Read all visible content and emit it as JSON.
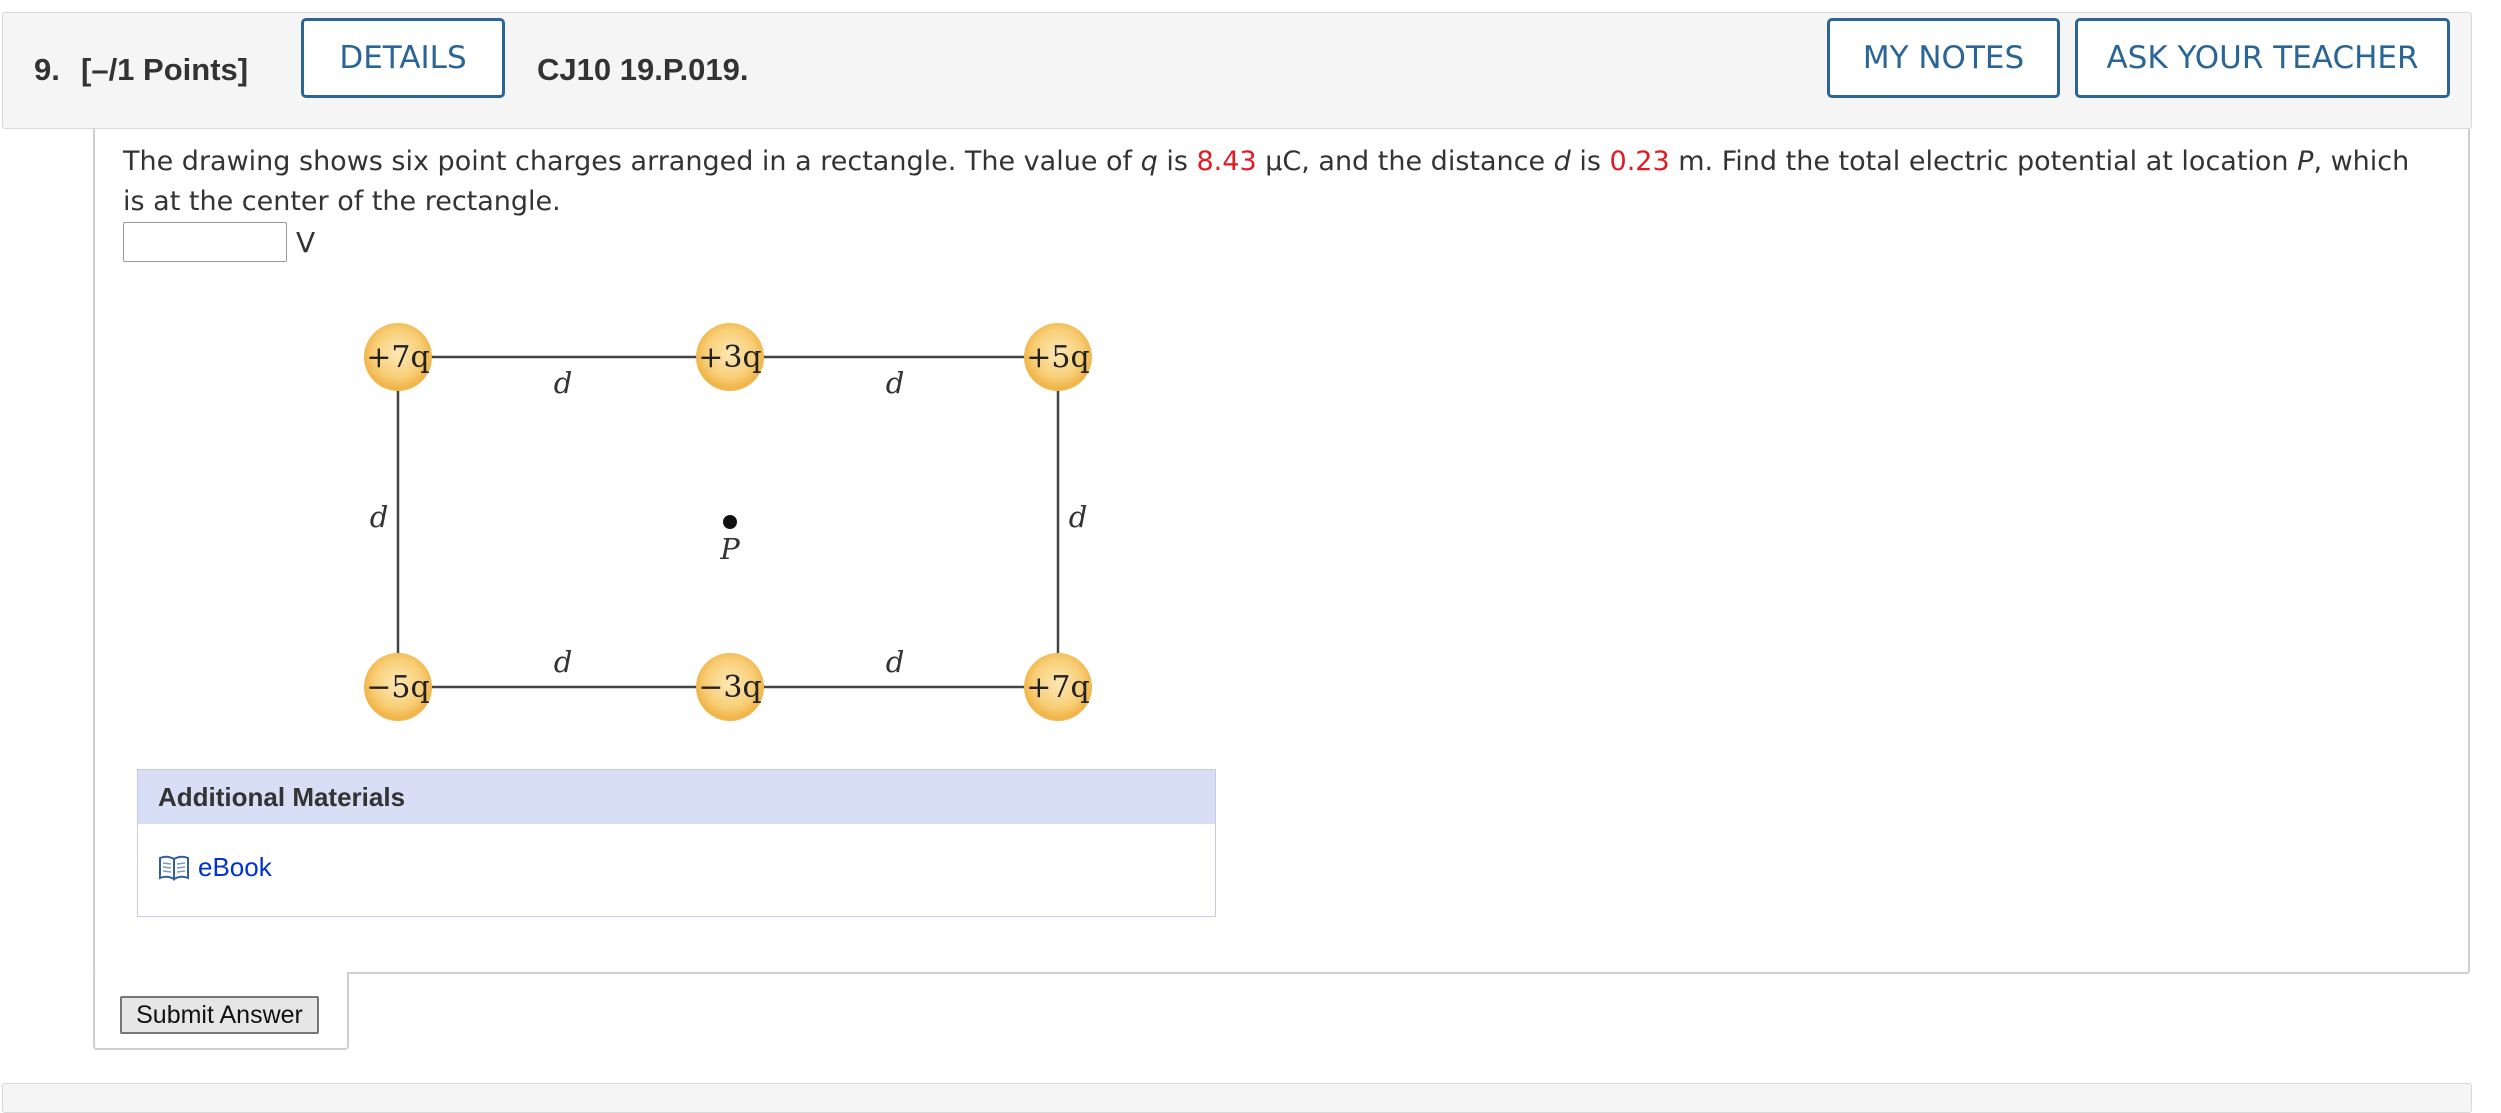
{
  "question": {
    "number": "9.",
    "points": "[–/1 Points]",
    "details_label": "DETAILS",
    "code": "CJ10 19.P.019.",
    "my_notes_label": "MY NOTES",
    "ask_teacher_label": "ASK YOUR TEACHER"
  },
  "prompt": {
    "part1": "The drawing shows six point charges arranged in a rectangle. The value of ",
    "q_symbol": "q",
    "part2": " is ",
    "q_value": "8.43",
    "part3": " μC, and the distance ",
    "d_symbol": "d",
    "part4": " is ",
    "d_value": "0.23",
    "part5": " m. Find the total electric potential at location ",
    "p_symbol": "P",
    "part6": ", which is at the center of the rectangle.",
    "value_color": "#e01b24"
  },
  "answer": {
    "value": "",
    "unit": "V"
  },
  "figure": {
    "charges": {
      "top_left": "+7q",
      "top_middle": "+3q",
      "top_right": "+5q",
      "bottom_left": "−5q",
      "bottom_middle": "−3q",
      "bottom_right": "+7q"
    },
    "distance_label": "d",
    "point_label": "P",
    "charge_color": "#f7c56a"
  },
  "materials": {
    "title": "Additional Materials",
    "ebook_label": "eBook"
  },
  "submit_label": "Submit Answer"
}
